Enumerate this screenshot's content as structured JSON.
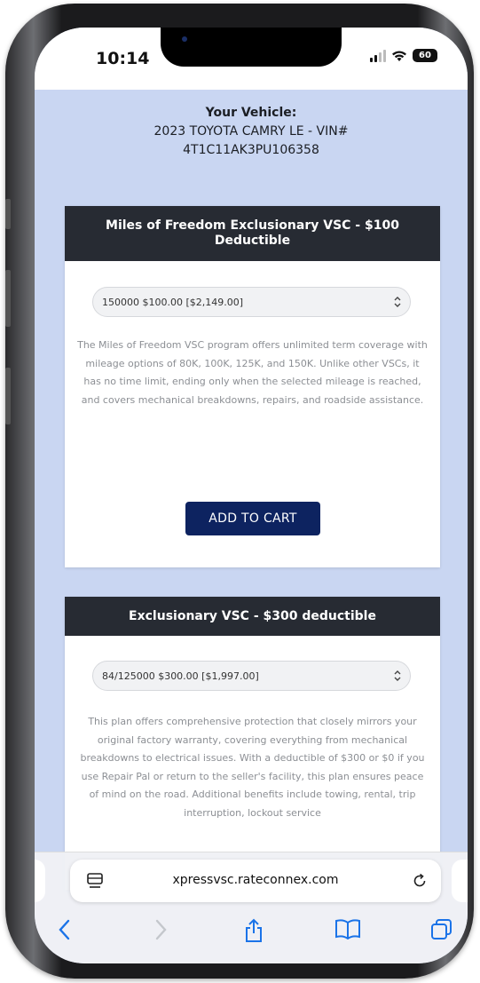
{
  "status_bar": {
    "time": "10:14",
    "battery": "60"
  },
  "vehicle": {
    "title": "Your Vehicle:",
    "line1": "2023 TOYOTA CAMRY LE - VIN#",
    "line2": "4T1C11AK3PU106358"
  },
  "products": [
    {
      "title": "Miles of Freedom Exclusionary VSC - $100 Deductible",
      "selected_option": "150000 $100.00 [$2,149.00]",
      "description": "The Miles of Freedom VSC program offers unlimited term coverage with mileage options of 80K, 100K, 125K, and 150K. Unlike other VSCs, it has no time limit, ending only when the selected mileage is reached, and covers mechanical breakdowns, repairs, and roadside assistance.",
      "button_label": "ADD TO CART"
    },
    {
      "title": "Exclusionary VSC - $300 deductible",
      "selected_option": "84/125000 $300.00 [$1,997.00]",
      "description": "This plan offers comprehensive protection that closely mirrors your original factory warranty, covering everything from mechanical breakdowns to electrical issues. With a deductible of $300 or $0 if you use Repair Pal or return to the seller's facility, this plan ensures peace of mind on the road. Additional benefits include towing, rental, trip interruption, lockout service"
    }
  ],
  "browser": {
    "url": "xpressvsc.rateconnex.com"
  },
  "icons": {
    "back": "chevron-left-icon",
    "forward": "chevron-right-icon",
    "share": "share-icon",
    "bookmarks": "book-icon",
    "tabs": "tabs-icon",
    "reload": "reload-icon"
  },
  "colors": {
    "page_bg": "#c9d6f2",
    "card_header": "#272b33",
    "button": "#0d2360",
    "toolbar_accent": "#1a73e8"
  }
}
